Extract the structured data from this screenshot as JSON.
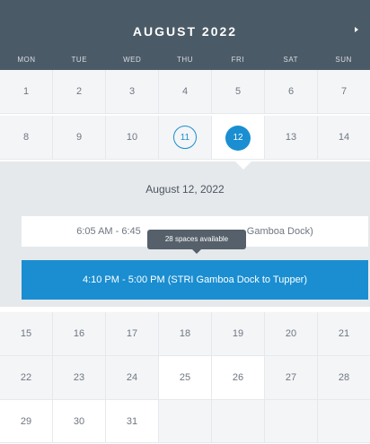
{
  "calendar": {
    "month_title": "AUGUST 2022",
    "next_icon": "chevron-right-icon",
    "weekdays": [
      "MON",
      "TUE",
      "WED",
      "THU",
      "FRI",
      "SAT",
      "SUN"
    ],
    "week1": [
      "1",
      "2",
      "3",
      "4",
      "5",
      "6",
      "7"
    ],
    "week2": [
      "8",
      "9",
      "10",
      "11",
      "12",
      "13",
      "14"
    ],
    "week3": [
      "15",
      "16",
      "17",
      "18",
      "19",
      "20",
      "21"
    ],
    "week4": [
      "22",
      "23",
      "24",
      "25",
      "26",
      "27",
      "28"
    ],
    "week5": [
      "29",
      "30",
      "31"
    ],
    "today": "11",
    "selected": "12"
  },
  "detail": {
    "date_label": "August 12, 2022",
    "slot1_start": "6:05 AM - 6:45",
    "slot1_end": "Gamboa Dock)",
    "slot2_label": "4:10 PM - 5:00 PM (STRI Gamboa Dock to Tupper)",
    "tooltip": "28 spaces available"
  },
  "colors": {
    "header_bg": "#4b5a67",
    "accent": "#1a8ed1",
    "panel_bg": "#e6e9ec"
  }
}
